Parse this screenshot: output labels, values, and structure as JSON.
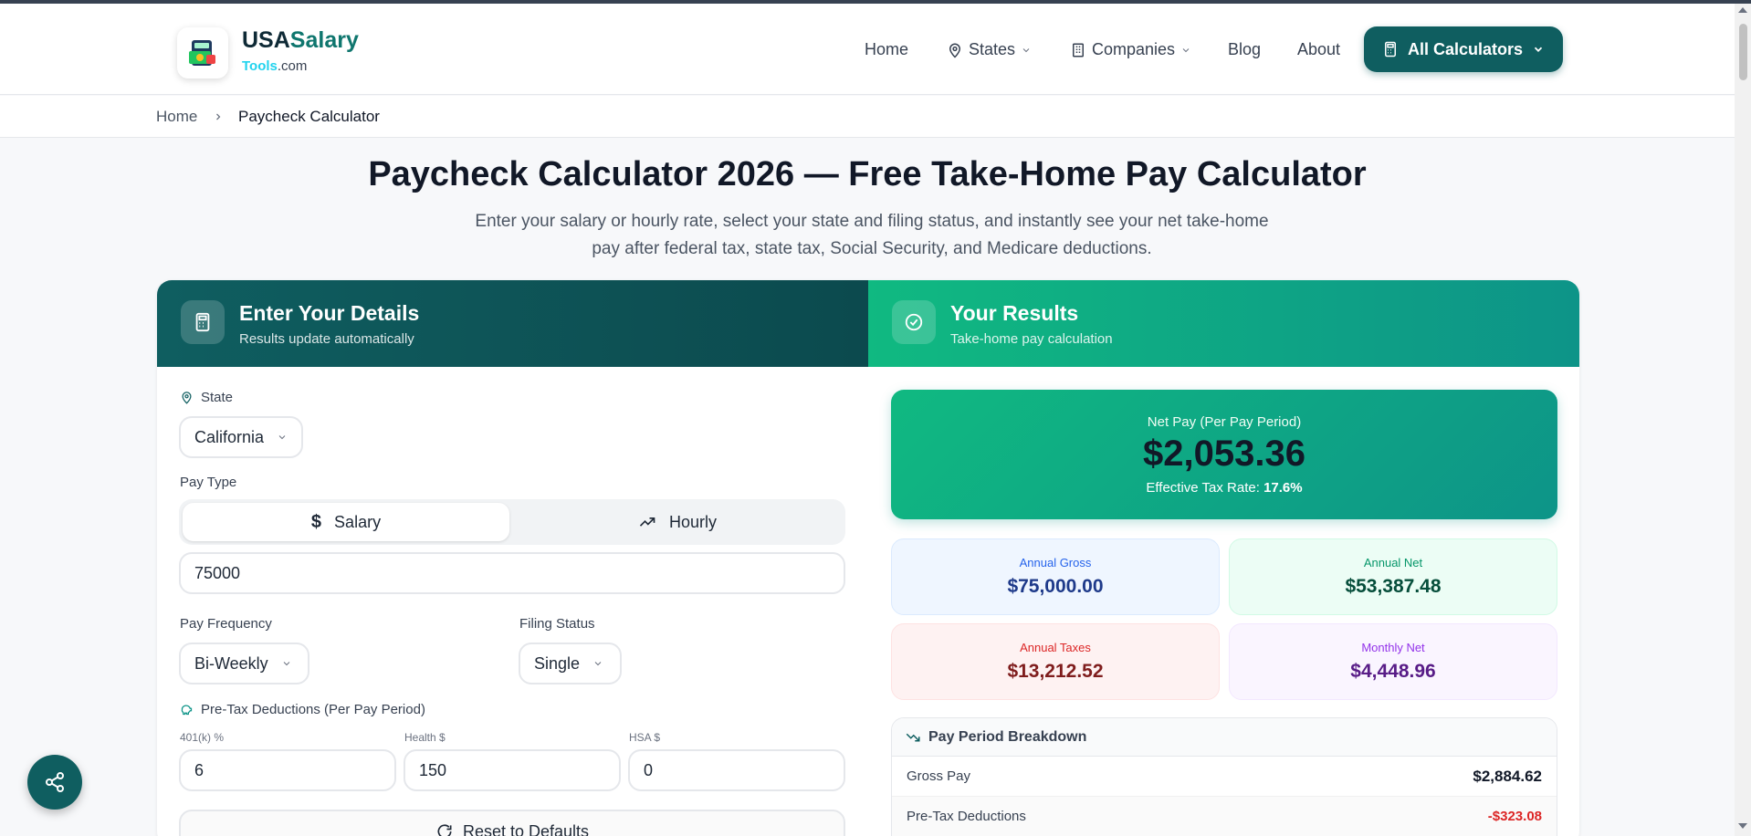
{
  "brand": {
    "name_part1": "USA",
    "name_part2": "Salary",
    "domain_part1": "Tools",
    "domain_part2": ".com"
  },
  "nav": {
    "home": "Home",
    "states": "States",
    "companies": "Companies",
    "blog": "Blog",
    "about": "About",
    "all_calculators": "All Calculators"
  },
  "breadcrumb": {
    "home": "Home",
    "current": "Paycheck Calculator"
  },
  "page": {
    "title": "Paycheck Calculator 2026 — Free Take-Home Pay Calculator",
    "subtitle": "Enter your salary or hourly rate, select your state and filing status, and instantly see your net take-home pay after federal tax, state tax, Social Security, and Medicare deductions."
  },
  "details": {
    "title": "Enter Your Details",
    "subtitle": "Results update automatically",
    "state_label": "State",
    "state_value": "California",
    "pay_type_label": "Pay Type",
    "pay_type_salary": "Salary",
    "pay_type_hourly": "Hourly",
    "amount_value": "75000",
    "pay_frequency_label": "Pay Frequency",
    "pay_frequency_value": "Bi-Weekly",
    "filing_status_label": "Filing Status",
    "filing_status_value": "Single",
    "pretax_label": "Pre-Tax Deductions (Per Pay Period)",
    "k401_label": "401(k) %",
    "k401_value": "6",
    "health_label": "Health $",
    "health_value": "150",
    "hsa_label": "HSA $",
    "hsa_value": "0",
    "reset_label": "Reset to Defaults"
  },
  "results": {
    "title": "Your Results",
    "subtitle": "Take-home pay calculation",
    "net_pay_label": "Net Pay (Per Pay Period)",
    "net_pay_value": "$2,053.36",
    "effective_rate_label": "Effective Tax Rate:",
    "effective_rate_value": "17.6%",
    "annual_gross_label": "Annual Gross",
    "annual_gross_value": "$75,000.00",
    "annual_net_label": "Annual Net",
    "annual_net_value": "$53,387.48",
    "annual_taxes_label": "Annual Taxes",
    "annual_taxes_value": "$13,212.52",
    "monthly_net_label": "Monthly Net",
    "monthly_net_value": "$4,448.96",
    "breakdown_title": "Pay Period Breakdown",
    "breakdown_rows": [
      {
        "label": "Gross Pay",
        "value": "$2,884.62"
      },
      {
        "label": "Pre-Tax Deductions",
        "value": "-$323.08"
      }
    ]
  },
  "colors": {
    "brand_dark": "#0f5e60",
    "accent_green": "#10b981",
    "negative": "#dc2626"
  }
}
